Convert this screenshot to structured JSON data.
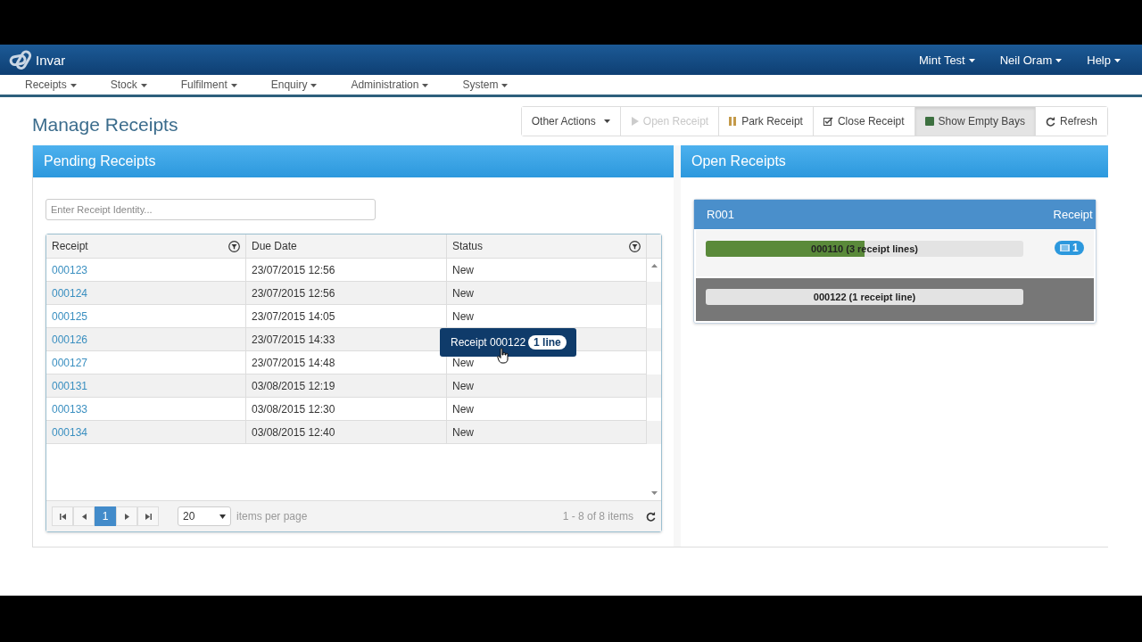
{
  "brand": {
    "name": "Invar"
  },
  "user_menus": [
    {
      "label": "Mint Test"
    },
    {
      "label": "Neil Oram"
    },
    {
      "label": "Help"
    }
  ],
  "menu": [
    {
      "label": "Receipts"
    },
    {
      "label": "Stock"
    },
    {
      "label": "Fulfilment"
    },
    {
      "label": "Enquiry"
    },
    {
      "label": "Administration"
    },
    {
      "label": "System"
    }
  ],
  "page_title": "Manage Receipts",
  "toolbar": [
    {
      "kind": "menu",
      "label": "Other Actions",
      "disabled": false,
      "selected": false
    },
    {
      "kind": "open",
      "label": "Open Receipt",
      "disabled": true,
      "selected": false
    },
    {
      "kind": "park",
      "label": "Park Receipt",
      "disabled": false,
      "selected": false
    },
    {
      "kind": "close",
      "label": "Close Receipt",
      "disabled": false,
      "selected": false
    },
    {
      "kind": "bays",
      "label": "Show Empty Bays",
      "disabled": false,
      "selected": true
    },
    {
      "kind": "refresh",
      "label": "Refresh",
      "disabled": false,
      "selected": false
    }
  ],
  "pending": {
    "title": "Pending Receipts",
    "search": {
      "placeholder": "Enter Receipt Identity..."
    },
    "columns": [
      {
        "label": "Receipt",
        "filter": true
      },
      {
        "label": "Due Date",
        "filter": false
      },
      {
        "label": "Status",
        "filter": true
      }
    ],
    "rows": [
      {
        "receipt": "000123",
        "due": "23/07/2015 12:56",
        "status": "New"
      },
      {
        "receipt": "000124",
        "due": "23/07/2015 12:56",
        "status": "New"
      },
      {
        "receipt": "000125",
        "due": "23/07/2015 14:05",
        "status": "New"
      },
      {
        "receipt": "000126",
        "due": "23/07/2015 14:33"
      },
      {
        "receipt": "000127",
        "due": "23/07/2015 14:48",
        "status": "New"
      },
      {
        "receipt": "000131",
        "due": "03/08/2015 12:19",
        "status": "New"
      },
      {
        "receipt": "000133",
        "due": "03/08/2015 12:30",
        "status": "New"
      },
      {
        "receipt": "000134",
        "due": "03/08/2015 12:40",
        "status": "New"
      }
    ],
    "pager": {
      "pages": [
        {
          "label": "1",
          "selected": true
        }
      ],
      "page_size": "20",
      "page_size_label": "items per page",
      "summary": "1 - 8 of 8 items"
    },
    "drag_tooltip": {
      "label": "Receipt 000122",
      "badge": "1 line"
    }
  },
  "open": {
    "title": "Open Receipts",
    "bay": {
      "name": "R001",
      "type": "Receipt",
      "slots": [
        {
          "label": "000110 (3 receipt lines)",
          "level": 0.5,
          "highlighted": false,
          "badge": "1"
        },
        {
          "label": "000122 (1 receipt line)",
          "level": 0,
          "highlighted": true
        }
      ]
    }
  }
}
